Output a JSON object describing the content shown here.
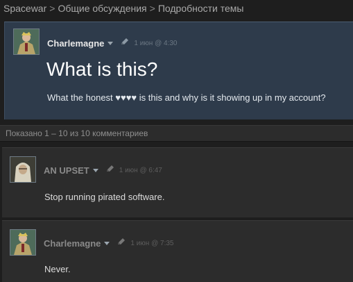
{
  "breadcrumb": {
    "items": [
      "Spacewar",
      "Общие обсуждения",
      "Подробности темы"
    ],
    "separator": ">"
  },
  "topic": {
    "author": "Charlemagne",
    "date": "1 июн @ 4:30",
    "title": "What is this?",
    "body": "What the honest ♥♥♥♥ is this and why is it showing up in my account?"
  },
  "comments_info": {
    "text": "Показано 1 – 10 из 10 комментариев"
  },
  "comments": [
    {
      "author": "AN UPSET",
      "date": "1 июн @ 6:47",
      "text": "Stop running pirated software."
    },
    {
      "author": "Charlemagne",
      "date": "1 июн @ 7:35",
      "text": "Never."
    }
  ],
  "icons": {
    "author_menu": "chevron-down-icon",
    "edit": "pencil-icon"
  },
  "colors": {
    "page_bg": "#1e1e1e",
    "topic_bg": "#2e3b4b",
    "comment_bg": "#2c2c2c",
    "title": "#ffffff"
  }
}
